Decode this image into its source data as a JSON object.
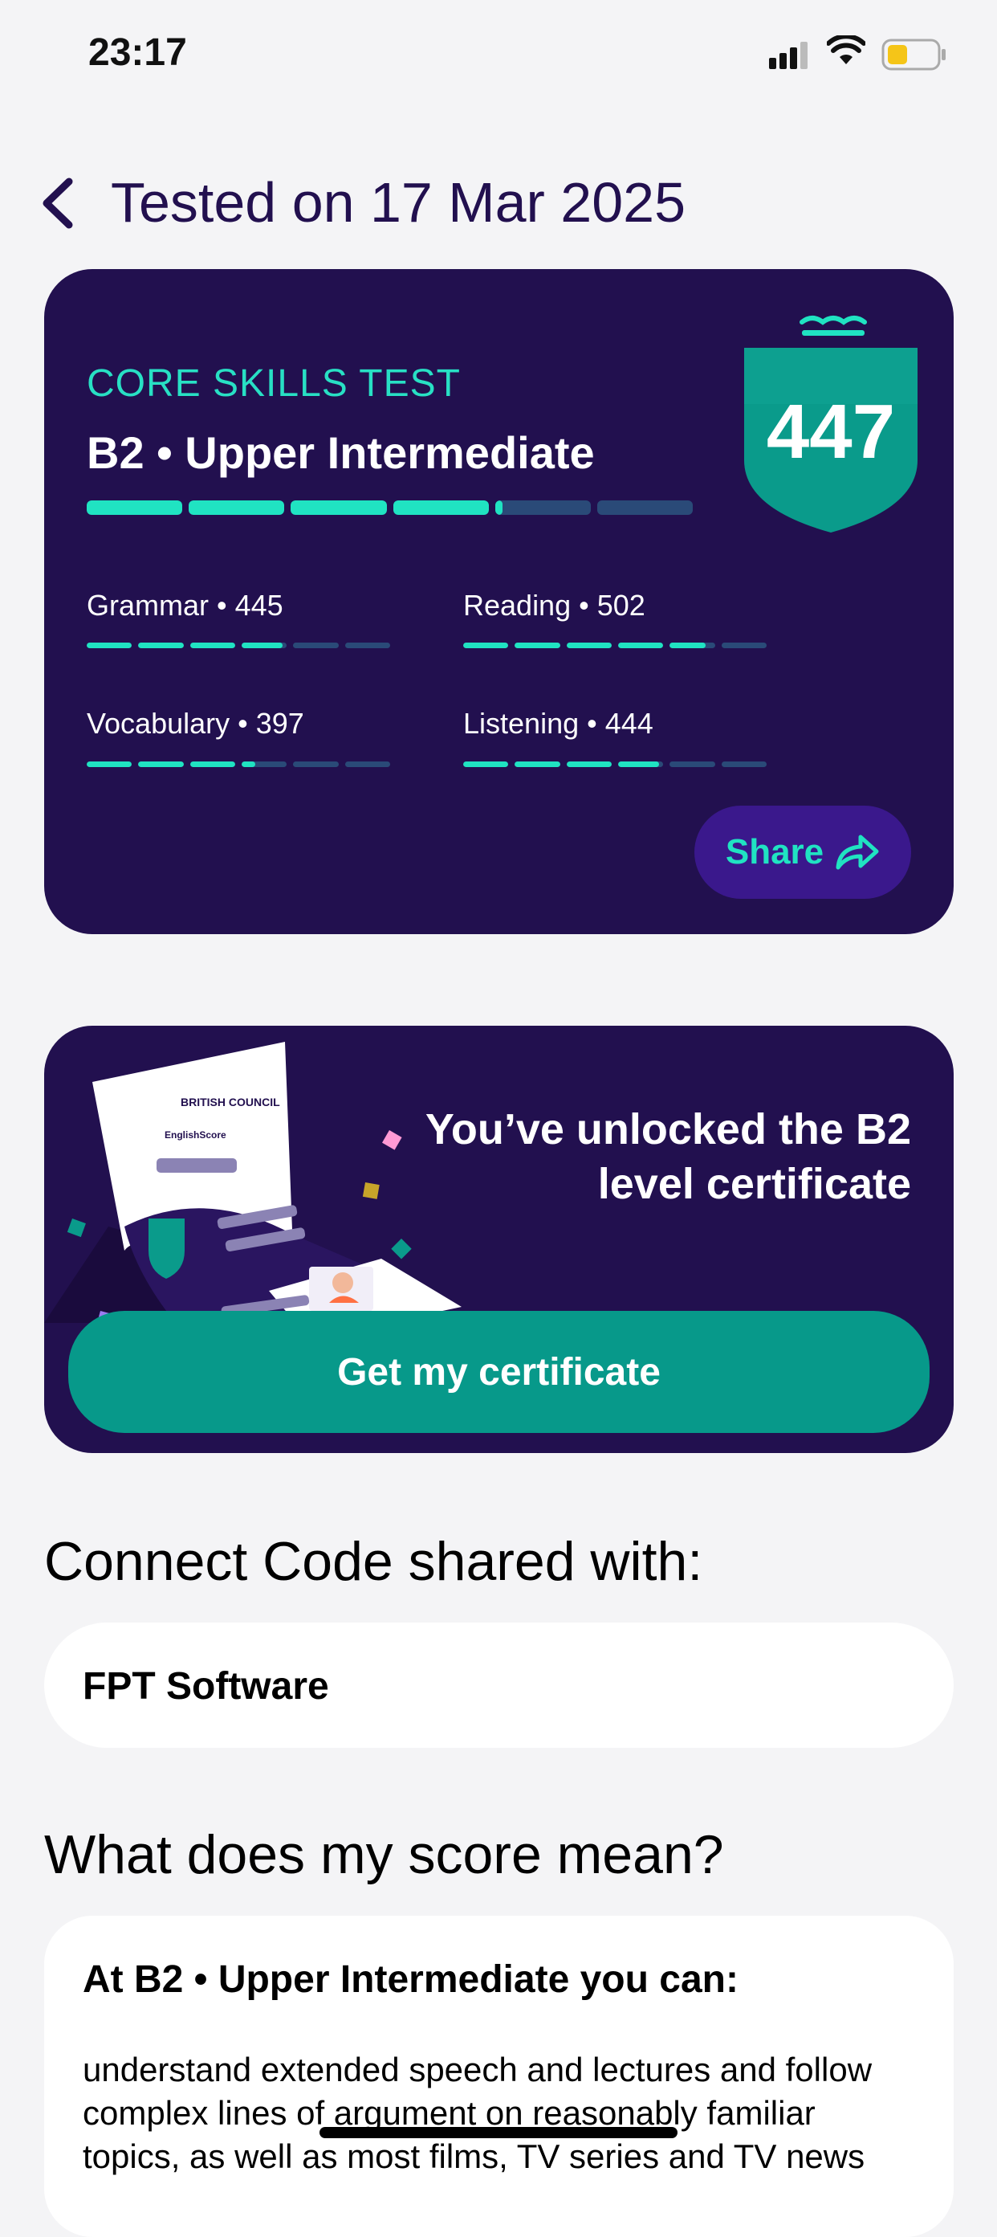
{
  "status_bar": {
    "time": "23:17"
  },
  "header": {
    "title": "Tested on 17 Mar 2025"
  },
  "score_card": {
    "test_name": "CORE SKILLS TEST",
    "level": "B2 • Upper Intermediate",
    "overall_score": "447",
    "overall_progress_fraction": 0.68,
    "skills": [
      {
        "label": "Grammar • 445",
        "progress_fraction": 0.65
      },
      {
        "label": "Reading • 502",
        "progress_fraction": 0.8
      },
      {
        "label": "Vocabulary • 397",
        "progress_fraction": 0.55
      },
      {
        "label": "Listening • 444",
        "progress_fraction": 0.65
      }
    ],
    "share_label": "Share"
  },
  "certificate_card": {
    "message": "You’ve unlocked the B2 level certificate",
    "button_label": "Get my certificate",
    "art_brand_1": "BRITISH COUNCIL",
    "art_brand_2": "EnglishScore"
  },
  "connect_code": {
    "heading": "Connect Code shared with:",
    "company": "FPT Software"
  },
  "score_meaning": {
    "heading": "What does my score mean?",
    "card_title": "At B2 • Upper Intermediate you can:",
    "description": "understand extended speech and lectures and follow complex lines of argument on reasonably familiar topics, as well as most films, TV series and TV news"
  },
  "colors": {
    "brand_purple": "#22104f",
    "accent_teal": "#20e3c2",
    "button_teal": "#07998a"
  }
}
